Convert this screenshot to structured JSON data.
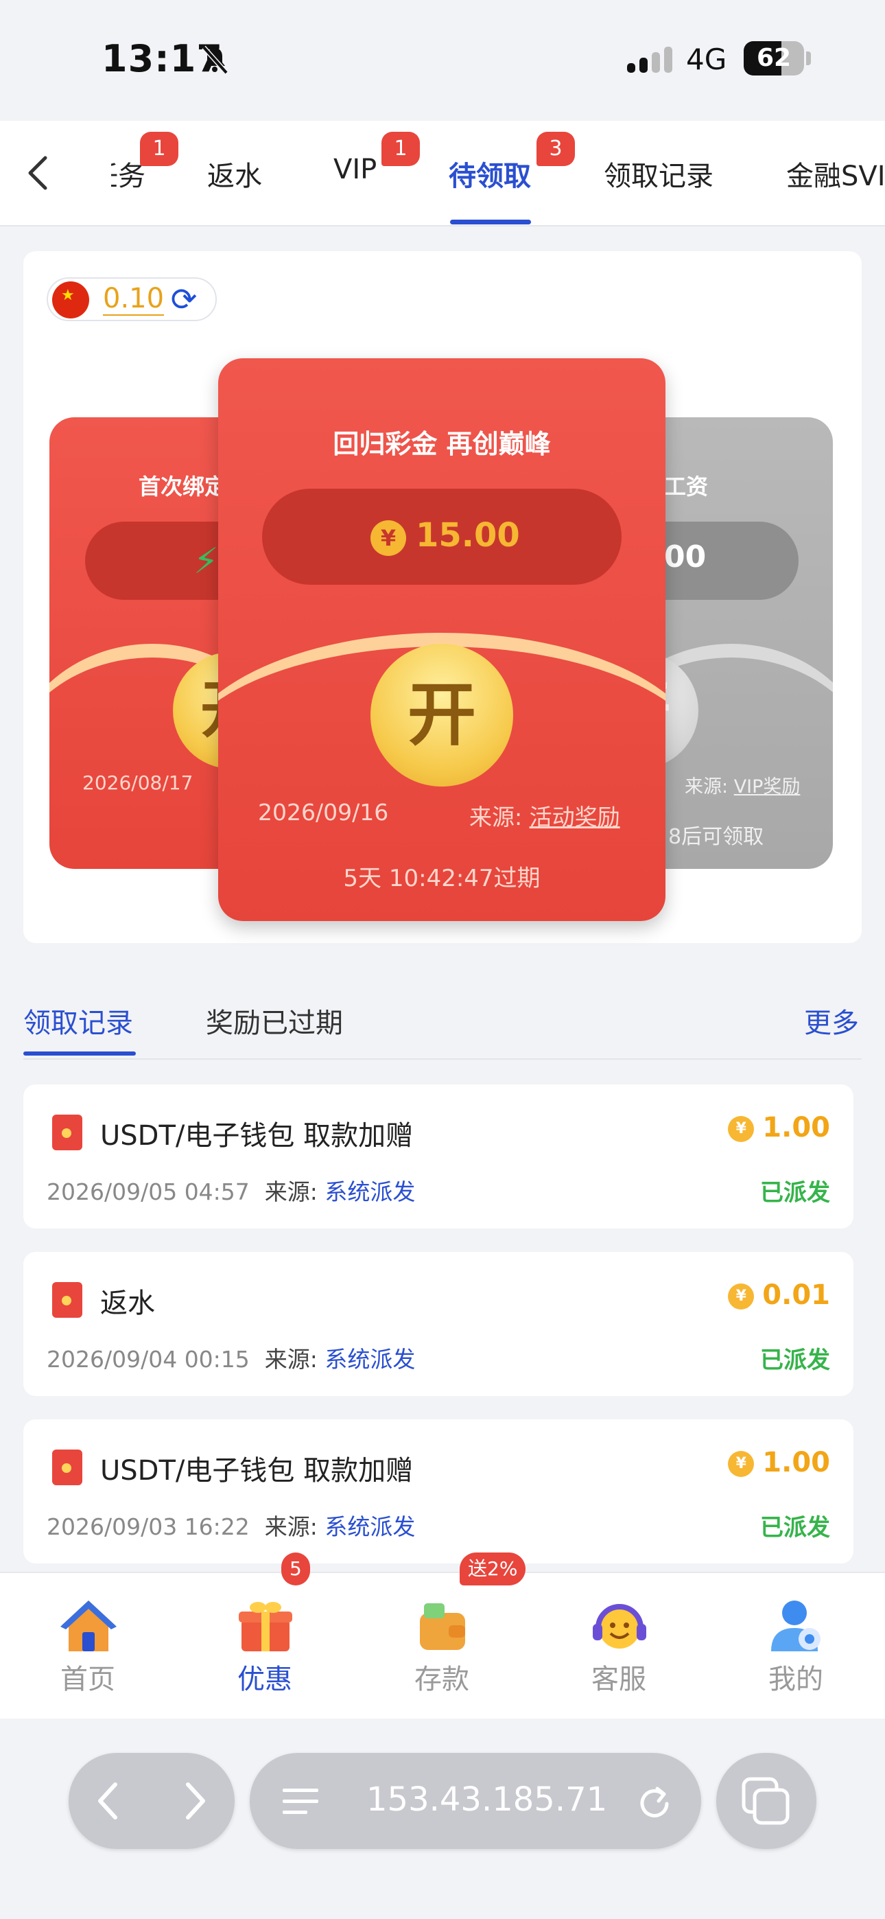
{
  "status_bar": {
    "time": "13:17",
    "network": "4G",
    "battery": "62",
    "battery_level": 0.62
  },
  "tabs": [
    {
      "label": "任务",
      "badge": "1"
    },
    {
      "label": "返水",
      "badge": ""
    },
    {
      "label": "VIP",
      "badge": "1"
    },
    {
      "label": "待领取",
      "badge": "3",
      "active": true
    },
    {
      "label": "领取记录",
      "badge": ""
    },
    {
      "label": "金融SVIP",
      "badge": ""
    }
  ],
  "balance": {
    "value": "0.10"
  },
  "envelopes": {
    "left": {
      "title": "首次绑定",
      "date": "2026/08/17",
      "action": "开"
    },
    "center": {
      "title": "回归彩金 再创巅峰",
      "amount": "15.00",
      "action": "开",
      "date": "2026/09/16",
      "source_label": "来源:",
      "source": "活动奖励",
      "expiry": "5天 10:42:47过期"
    },
    "right": {
      "title": "工资",
      "amount": "00",
      "source_label": "来源:",
      "source": "VIP奖励",
      "note": "8后可领取",
      "action": "开"
    }
  },
  "subtabs": {
    "items": [
      "领取记录",
      "奖励已过期"
    ],
    "more": "更多"
  },
  "records": [
    {
      "title": "USDT/电子钱包 取款加赠",
      "time": "2026/09/05 04:57",
      "source_label": "来源:",
      "source": "系统派发",
      "amount": "1.00",
      "status": "已派发"
    },
    {
      "title": "返水",
      "time": "2026/09/04 00:15",
      "source_label": "来源:",
      "source": "系统派发",
      "amount": "0.01",
      "status": "已派发"
    },
    {
      "title": "USDT/电子钱包 取款加赠",
      "time": "2026/09/03 16:22",
      "source_label": "来源:",
      "source": "系统派发",
      "amount": "1.00",
      "status": "已派发"
    }
  ],
  "bottom_nav": [
    {
      "label": "首页",
      "icon": "home-icon"
    },
    {
      "label": "优惠",
      "icon": "gift-icon",
      "badge": "5",
      "active": true
    },
    {
      "label": "存款",
      "icon": "wallet-icon",
      "badge": "送2%"
    },
    {
      "label": "客服",
      "icon": "headset-icon"
    },
    {
      "label": "我的",
      "icon": "user-icon"
    }
  ],
  "browser": {
    "url": "153.43.185.71"
  },
  "colors": {
    "accent": "#2a4fd0",
    "red": "#e8453c",
    "gold": "#f2a516",
    "green": "#35b44a"
  }
}
